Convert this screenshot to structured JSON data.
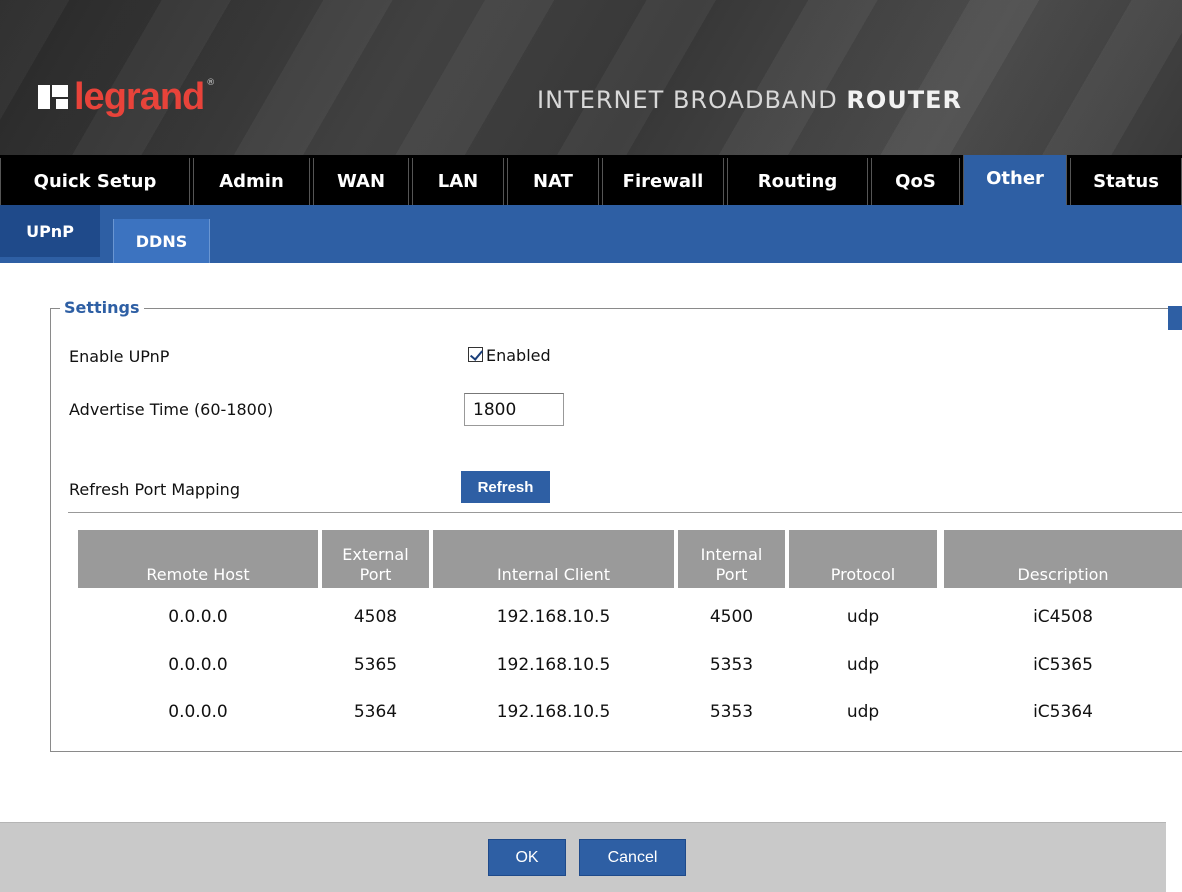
{
  "brand": {
    "logo_text": "legrand",
    "registered": "®",
    "title_light": "INTERNET BROADBAND ",
    "title_bold": "ROUTER"
  },
  "main_tabs": [
    "Quick Setup",
    "Admin",
    "WAN",
    "LAN",
    "NAT",
    "Firewall",
    "Routing",
    "QoS",
    "Other",
    "Status"
  ],
  "active_main_tab": "Other",
  "sub_tabs": [
    "UPnP",
    "DDNS"
  ],
  "active_sub_tab": "UPnP",
  "settings": {
    "legend": "Settings",
    "enable_label": "Enable UPnP",
    "enable_checkbox_label": "Enabled",
    "enable_checked": true,
    "advertise_label": "Advertise Time (60-1800)",
    "advertise_value": "1800",
    "refresh_label": "Refresh Port Mapping",
    "refresh_button": "Refresh"
  },
  "table": {
    "headers": [
      {
        "line1": "",
        "line2": "Remote Host"
      },
      {
        "line1": "External",
        "line2": "Port"
      },
      {
        "line1": "",
        "line2": "Internal Client"
      },
      {
        "line1": "Internal",
        "line2": "Port"
      },
      {
        "line1": "",
        "line2": "Protocol"
      },
      {
        "line1": "",
        "line2": "Description"
      }
    ],
    "rows": [
      [
        "0.0.0.0",
        "4508",
        "192.168.10.5",
        "4500",
        "udp",
        "iC4508"
      ],
      [
        "0.0.0.0",
        "5365",
        "192.168.10.5",
        "5353",
        "udp",
        "iC5365"
      ],
      [
        "0.0.0.0",
        "5364",
        "192.168.10.5",
        "5353",
        "udp",
        "iC5364"
      ]
    ]
  },
  "footer": {
    "ok": "OK",
    "cancel": "Cancel"
  },
  "colors": {
    "accent": "#2e5fa4",
    "brand_red": "#e8433a",
    "header_bg": "#3a3a3a",
    "tab_bar": "#000000",
    "table_header": "#9a9a9a"
  }
}
